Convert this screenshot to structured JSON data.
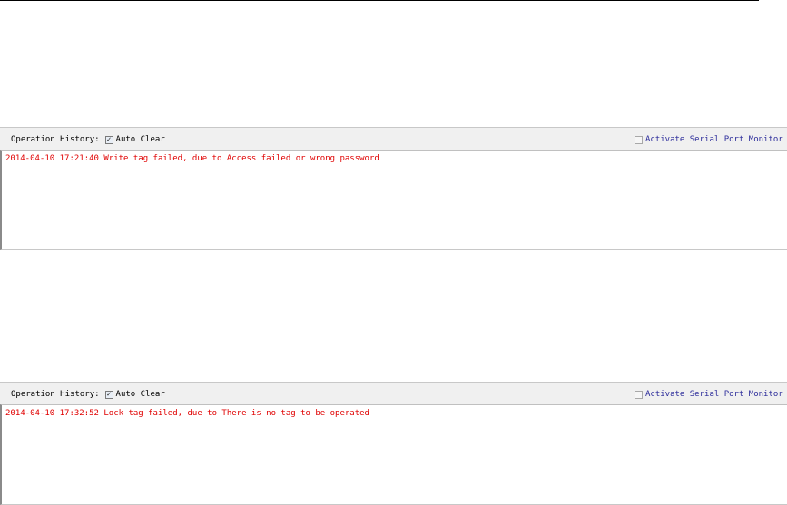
{
  "panels": [
    {
      "history_label": "Operation History:",
      "auto_clear_label": "Auto Clear",
      "auto_clear_checked": true,
      "monitor_label": "Activate Serial Port Monitor",
      "monitor_checked": false,
      "log_lines": [
        "2014-04-10 17:21:40 Write tag failed, due to Access failed or wrong password"
      ]
    },
    {
      "history_label": "Operation History:",
      "auto_clear_label": "Auto Clear",
      "auto_clear_checked": true,
      "monitor_label": "Activate Serial Port Monitor",
      "monitor_checked": false,
      "log_lines": [
        "2014-04-10 17:32:52 Lock tag failed, due to There is no tag to be operated"
      ]
    }
  ],
  "colors": {
    "log_error": "#e00000",
    "monitor_label": "#2b2b9a",
    "header_bg": "#f0f0f0"
  },
  "icons": {
    "checked": "checkbox-checked-icon",
    "unchecked": "checkbox-unchecked-icon"
  }
}
